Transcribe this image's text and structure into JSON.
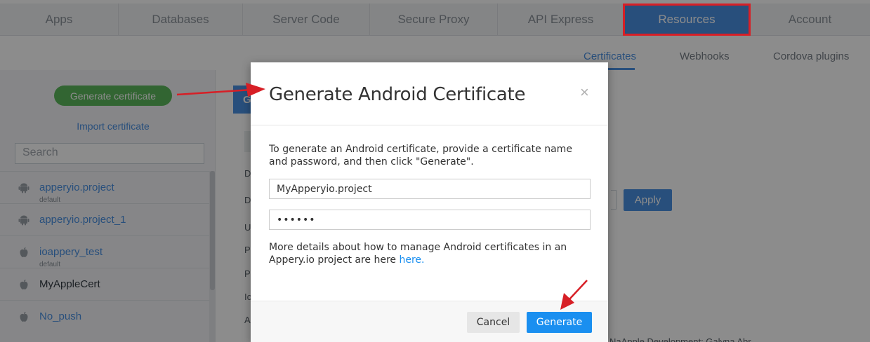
{
  "topnav": {
    "tabs": [
      {
        "label": "Apps"
      },
      {
        "label": "Databases"
      },
      {
        "label": "Server Code"
      },
      {
        "label": "Secure Proxy"
      },
      {
        "label": "API Express"
      },
      {
        "label": "Resources"
      },
      {
        "label": "Account"
      }
    ],
    "active_tab": "Resources"
  },
  "subnav": {
    "items": [
      {
        "label": "Certificates"
      },
      {
        "label": "Webhooks"
      },
      {
        "label": "Cordova plugins"
      }
    ],
    "active_item": "Certificates"
  },
  "sidebar": {
    "generate_button": "Generate certificate",
    "import_link": "Import certificate",
    "search_placeholder": "Search",
    "certificates": [
      {
        "name": "apperyio.project",
        "sub": "default",
        "platform": "android-icon"
      },
      {
        "name": "apperyio.project_1",
        "sub": "",
        "platform": "android-icon"
      },
      {
        "name": "ioappery_test",
        "sub": "default",
        "platform": "apple-icon"
      },
      {
        "name": "MyAppleCert",
        "sub": "",
        "platform": "apple-icon"
      },
      {
        "name": "No_push",
        "sub": "",
        "platform": "apple-icon"
      }
    ]
  },
  "main": {
    "button_fragment": "G",
    "row_letters": [
      "D",
      "D",
      "U",
      "P",
      "P",
      "Ic",
      "A"
    ],
    "apply_button": "Apply",
    "footer_fragment": "NaApple Development: Galyna Abr..."
  },
  "modal": {
    "title": "Generate Android Certificate",
    "close_glyph": "×",
    "description": "To generate an Android certificate, provide a certificate name and password, and then click \"Generate\".",
    "name_value": "MyApperyio.project",
    "password_mask": "••••••",
    "more_text": "More details about how to manage Android certificates in an Appery.io project are here",
    "more_link": "here.",
    "cancel_button": "Cancel",
    "generate_button": "Generate"
  },
  "colors": {
    "accent": "#4a90e2",
    "generate_blue": "#1a8ff0",
    "annotation_red": "#d71f26",
    "success_green": "#5cb85c"
  }
}
